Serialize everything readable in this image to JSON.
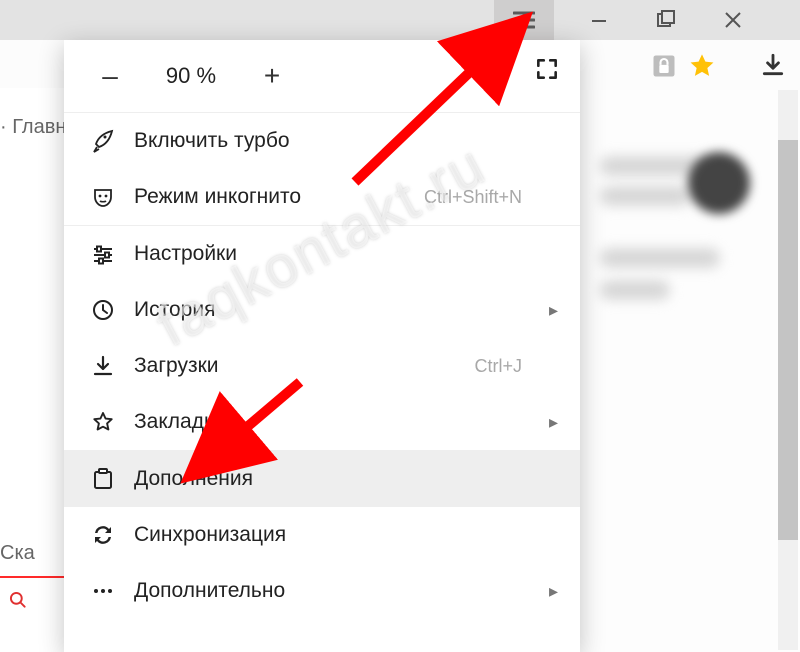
{
  "window": {
    "menu_tooltip": "Меню",
    "minimize_tooltip": "Свернуть",
    "maximize_tooltip": "Развернуть",
    "close_tooltip": "Закрыть"
  },
  "toolbar": {
    "lock": "lock",
    "star": "star",
    "downloads": "downloads",
    "overflow": "»"
  },
  "page_fragments": {
    "tab_text": "· Главн",
    "side_text": " Ска"
  },
  "zoom": {
    "minus": "–",
    "value": "90 %",
    "plus": "+"
  },
  "menu": {
    "turbo": "Включить турбо",
    "incognito": "Режим инкогнито",
    "incognito_shortcut": "Ctrl+Shift+N",
    "settings": "Настройки",
    "history": "История",
    "downloads": "Загрузки",
    "downloads_shortcut": "Ctrl+J",
    "bookmarks": "Закладки",
    "extensions": "Дополнения",
    "sync": "Синхронизация",
    "more": "Дополнительно"
  },
  "watermark": "faqkontakt.ru"
}
